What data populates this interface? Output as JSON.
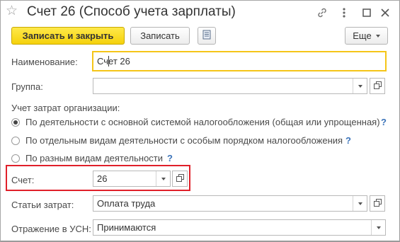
{
  "window": {
    "title": "Счет 26 (Способ учета зарплаты)"
  },
  "toolbar": {
    "save_close_label": "Записать и закрыть",
    "save_label": "Записать",
    "more_label": "Еще"
  },
  "form": {
    "name_label": "Наименование:",
    "name_value": "Счет 26",
    "group_label": "Группа:",
    "group_value": "",
    "cost_accounting_label": "Учет затрат организации:",
    "radio_options": [
      {
        "label": "По деятельности с основной системой налогообложения (общая или упрощенная)",
        "selected": true
      },
      {
        "label": "По отдельным видам деятельности с особым порядком налогообложения",
        "selected": false
      },
      {
        "label": "По разным видам деятельности",
        "selected": false
      }
    ],
    "help_mark": "?",
    "account_label": "Счет:",
    "account_value": "26",
    "cost_items_label": "Статьи затрат:",
    "cost_items_value": "Оплата труда",
    "usn_label": "Отражение в УСН:",
    "usn_value": "Принимаются"
  },
  "colors": {
    "primary_button": "#f5d10b",
    "focus_border": "#f5c518",
    "highlight_box": "#e0202a",
    "help_mark": "#3b73b9"
  },
  "icons": [
    "star-icon",
    "link-icon",
    "more-vertical-icon",
    "maximize-icon",
    "close-icon",
    "document-list-icon",
    "dropdown-icon",
    "open-icon"
  ]
}
